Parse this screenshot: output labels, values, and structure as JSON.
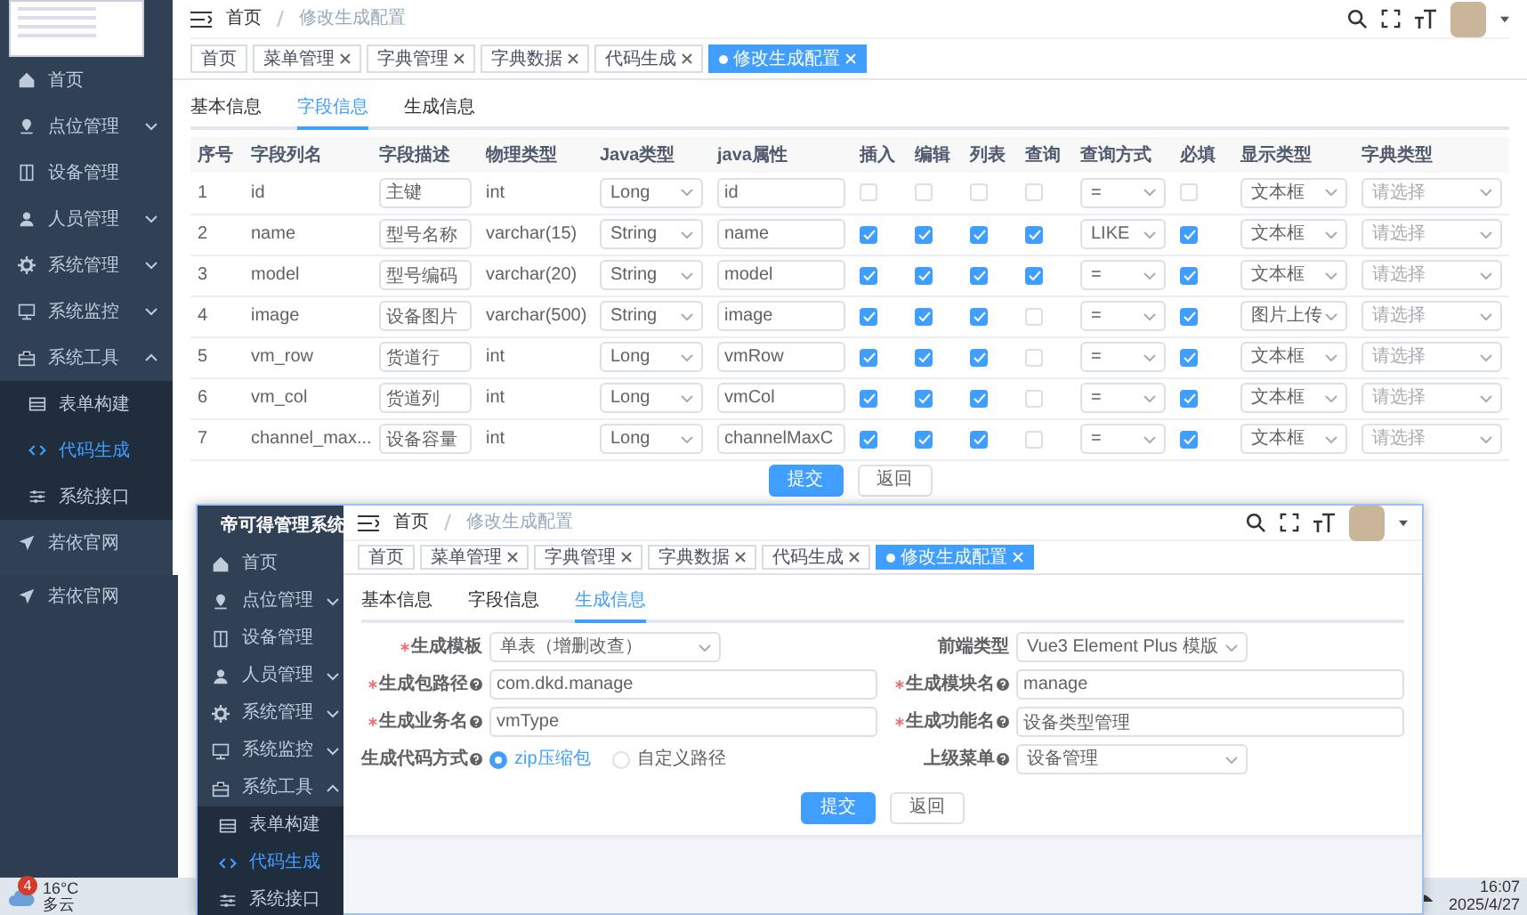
{
  "main_window": {
    "sidebar": {
      "items": [
        {
          "label": "首页",
          "expandable": false,
          "selected": false
        },
        {
          "label": "点位管理",
          "expandable": true,
          "expanded": false,
          "selected": false
        },
        {
          "label": "设备管理",
          "expandable": false,
          "selected": false
        },
        {
          "label": "人员管理",
          "expandable": true,
          "expanded": false,
          "selected": false
        },
        {
          "label": "系统管理",
          "expandable": true,
          "expanded": false,
          "selected": false
        },
        {
          "label": "系统监控",
          "expandable": true,
          "expanded": false,
          "selected": false
        },
        {
          "label": "系统工具",
          "expandable": true,
          "expanded": true,
          "selected": false,
          "children": [
            {
              "label": "表单构建",
              "selected": false
            },
            {
              "label": "代码生成",
              "selected": true
            },
            {
              "label": "系统接口",
              "selected": false
            }
          ]
        },
        {
          "label": "若依官网",
          "expandable": false,
          "selected": false
        }
      ]
    },
    "breadcrumb": [
      "首页",
      "修改生成配置"
    ],
    "tags": [
      {
        "label": "首页",
        "closable": false,
        "selected": false
      },
      {
        "label": "菜单管理",
        "closable": true,
        "selected": false
      },
      {
        "label": "字典管理",
        "closable": true,
        "selected": false
      },
      {
        "label": "字典数据",
        "closable": true,
        "selected": false
      },
      {
        "label": "代码生成",
        "closable": true,
        "selected": false
      },
      {
        "label": "修改生成配置",
        "closable": true,
        "selected": true
      }
    ],
    "subtabs": [
      {
        "label": "基本信息",
        "selected": false
      },
      {
        "label": "字段信息",
        "selected": true
      },
      {
        "label": "生成信息",
        "selected": false
      }
    ],
    "table": {
      "columns": [
        "序号",
        "字段列名",
        "字段描述",
        "物理类型",
        "Java类型",
        "java属性",
        "插入",
        "编辑",
        "列表",
        "查询",
        "查询方式",
        "必填",
        "显示类型",
        "字典类型"
      ],
      "rows": [
        {
          "index": "1",
          "column_name": "id",
          "description": "主键",
          "physical_type": "int",
          "java_type": "Long",
          "java_field": "id",
          "insert": false,
          "edit": false,
          "list": false,
          "query": false,
          "query_type": "=",
          "required": false,
          "display_type": "文本框",
          "dict_type": {
            "placeholder": "请选择"
          }
        },
        {
          "index": "2",
          "column_name": "name",
          "description": "型号名称",
          "physical_type": "varchar(15)",
          "java_type": "String",
          "java_field": "name",
          "insert": true,
          "edit": true,
          "list": true,
          "query": true,
          "query_type": "LIKE",
          "required": true,
          "display_type": "文本框",
          "dict_type": {
            "placeholder": "请选择"
          }
        },
        {
          "index": "3",
          "column_name": "model",
          "description": "型号编码",
          "physical_type": "varchar(20)",
          "java_type": "String",
          "java_field": "model",
          "insert": true,
          "edit": true,
          "list": true,
          "query": true,
          "query_type": "=",
          "required": true,
          "display_type": "文本框",
          "dict_type": {
            "placeholder": "请选择"
          }
        },
        {
          "index": "4",
          "column_name": "image",
          "description": "设备图片",
          "physical_type": "varchar(500)",
          "java_type": "String",
          "java_field": "image",
          "insert": true,
          "edit": true,
          "list": true,
          "query": false,
          "query_type": "=",
          "required": true,
          "display_type": "图片上传",
          "dict_type": {
            "placeholder": "请选择"
          }
        },
        {
          "index": "5",
          "column_name": "vm_row",
          "description": "货道行",
          "physical_type": "int",
          "java_type": "Long",
          "java_field": "vmRow",
          "insert": true,
          "edit": true,
          "list": true,
          "query": false,
          "query_type": "=",
          "required": true,
          "display_type": "文本框",
          "dict_type": {
            "placeholder": "请选择"
          }
        },
        {
          "index": "6",
          "column_name": "vm_col",
          "description": "货道列",
          "physical_type": "int",
          "java_type": "Long",
          "java_field": "vmCol",
          "insert": true,
          "edit": true,
          "list": true,
          "query": false,
          "query_type": "=",
          "required": true,
          "display_type": "文本框",
          "dict_type": {
            "placeholder": "请选择"
          }
        },
        {
          "index": "7",
          "column_name": "channel_max...",
          "description": "设备容量",
          "physical_type": "int",
          "java_type": "Long",
          "java_field": "channelMaxC",
          "insert": true,
          "edit": true,
          "list": true,
          "query": false,
          "query_type": "=",
          "required": true,
          "display_type": "文本框",
          "dict_type": {
            "placeholder": "请选择"
          }
        }
      ]
    },
    "buttons": [
      {
        "label": "提交",
        "kind": "primary"
      },
      {
        "label": "返回",
        "kind": "default"
      }
    ]
  },
  "background_panel": {
    "label": "若依官网"
  },
  "overlay_window": {
    "sidebar": {
      "title": "帝可得管理系统",
      "items": [
        {
          "label": "首页",
          "expandable": false,
          "selected": false
        },
        {
          "label": "点位管理",
          "expandable": true,
          "expanded": false,
          "selected": false
        },
        {
          "label": "设备管理",
          "expandable": false,
          "selected": false
        },
        {
          "label": "人员管理",
          "expandable": true,
          "expanded": false,
          "selected": false
        },
        {
          "label": "系统管理",
          "expandable": true,
          "expanded": false,
          "selected": false
        },
        {
          "label": "系统监控",
          "expandable": true,
          "expanded": false,
          "selected": false
        },
        {
          "label": "系统工具",
          "expandable": true,
          "expanded": true,
          "selected": false,
          "children": [
            {
              "label": "表单构建",
              "selected": false
            },
            {
              "label": "代码生成",
              "selected": true
            },
            {
              "label": "系统接口",
              "selected": false
            }
          ]
        }
      ]
    },
    "breadcrumb": [
      "首页",
      "修改生成配置"
    ],
    "tags": [
      {
        "label": "首页",
        "closable": false,
        "selected": false
      },
      {
        "label": "菜单管理",
        "closable": true,
        "selected": false
      },
      {
        "label": "字典管理",
        "closable": true,
        "selected": false
      },
      {
        "label": "字典数据",
        "closable": true,
        "selected": false
      },
      {
        "label": "代码生成",
        "closable": true,
        "selected": false
      },
      {
        "label": "修改生成配置",
        "closable": true,
        "selected": true
      }
    ],
    "subtabs": [
      {
        "label": "基本信息",
        "selected": false
      },
      {
        "label": "字段信息",
        "selected": false
      },
      {
        "label": "生成信息",
        "selected": true
      }
    ],
    "form": {
      "fields": [
        {
          "label": "生成模板",
          "required": true,
          "help": false,
          "kind": "select",
          "value": "单表（增删改查）"
        },
        {
          "label": "前端类型",
          "required": false,
          "help": false,
          "kind": "select",
          "value": "Vue3 Element Plus 模版"
        },
        {
          "label": "生成包路径",
          "required": true,
          "help": true,
          "kind": "input",
          "value": "com.dkd.manage"
        },
        {
          "label": "生成模块名",
          "required": true,
          "help": true,
          "kind": "input",
          "value": "manage"
        },
        {
          "label": "生成业务名",
          "required": true,
          "help": true,
          "kind": "input",
          "value": "vmType"
        },
        {
          "label": "生成功能名",
          "required": true,
          "help": true,
          "kind": "input",
          "value": "设备类型管理"
        },
        {
          "label": "生成代码方式",
          "required": false,
          "help": true,
          "kind": "radio",
          "options": [
            {
              "label": "zip压缩包",
              "selected": true
            },
            {
              "label": "自定义路径",
              "selected": false
            }
          ]
        },
        {
          "label": "上级菜单",
          "required": false,
          "help": true,
          "kind": "select",
          "value": "设备管理"
        }
      ]
    },
    "buttons": [
      {
        "label": "提交",
        "kind": "primary"
      },
      {
        "label": "返回",
        "kind": "default"
      }
    ]
  },
  "taskbar": {
    "weather": {
      "badge": "4",
      "temperature": "16°C",
      "condition": "多云"
    },
    "time": "16:07",
    "date": "2025/4/27"
  }
}
